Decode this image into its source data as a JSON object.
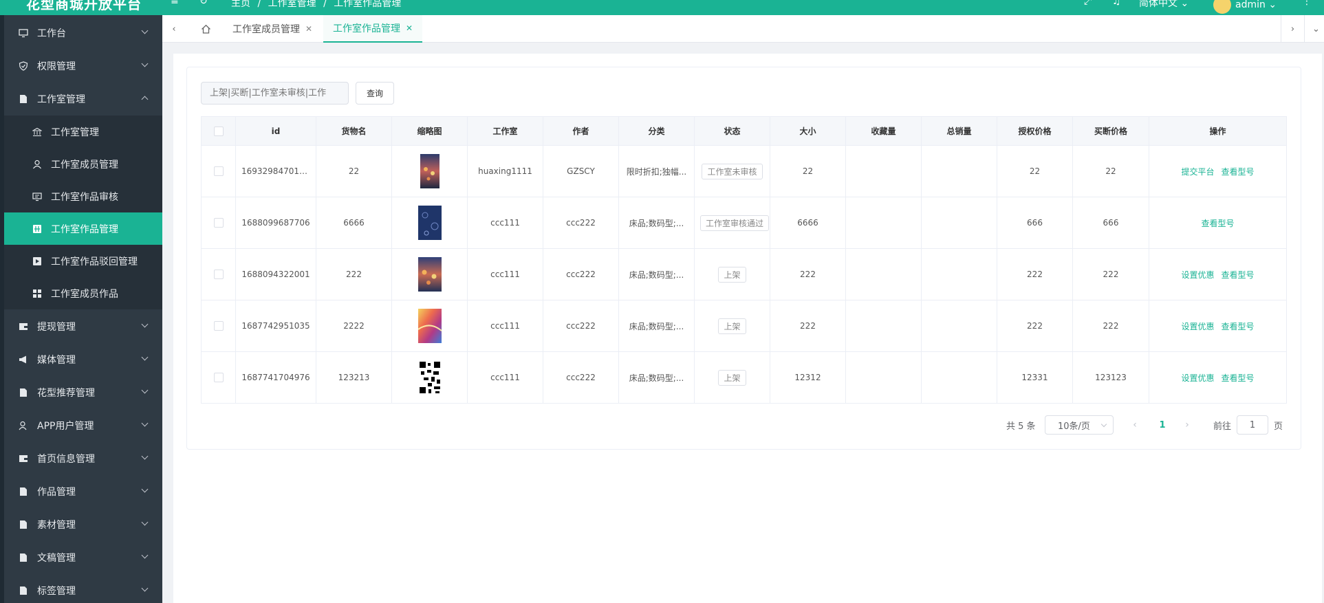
{
  "header": {
    "brand": "花型商城开放平台",
    "breadcrumb": [
      "主页",
      "/",
      "工作室管理",
      "/",
      "工作室作品管理"
    ],
    "language": "简体中文",
    "user": "admin"
  },
  "sidebar": {
    "items": [
      {
        "label": "工作台",
        "icon": "monitor-icon"
      },
      {
        "label": "权限管理",
        "icon": "shield-icon"
      },
      {
        "label": "工作室管理",
        "icon": "document-icon",
        "expanded": true
      },
      {
        "label": "提现管理",
        "icon": "wallet-icon"
      },
      {
        "label": "媒体管理",
        "icon": "megaphone-icon"
      },
      {
        "label": "花型推荐管理",
        "icon": "document-icon"
      },
      {
        "label": "APP用户管理",
        "icon": "user-icon"
      },
      {
        "label": "首页信息管理",
        "icon": "wallet-icon"
      },
      {
        "label": "作品管理",
        "icon": "document-icon"
      },
      {
        "label": "素材管理",
        "icon": "document-icon"
      },
      {
        "label": "文稿管理",
        "icon": "document-icon"
      },
      {
        "label": "标签管理",
        "icon": "document-icon"
      }
    ],
    "subitems": [
      {
        "label": "工作室管理",
        "icon": "bank-icon"
      },
      {
        "label": "工作室成员管理",
        "icon": "user-icon"
      },
      {
        "label": "工作室作品审核",
        "icon": "monitor-icon"
      },
      {
        "label": "工作室作品管理",
        "icon": "grid-icon",
        "active": true
      },
      {
        "label": "工作室作品驳回管理",
        "icon": "play-icon"
      },
      {
        "label": "工作室成员作品",
        "icon": "apps-icon"
      }
    ]
  },
  "tabs": [
    {
      "label": "工作室成员管理",
      "active": false
    },
    {
      "label": "工作室作品管理",
      "active": true
    }
  ],
  "search": {
    "placeholder": "上架|买断|工作室未审核|工作",
    "button": "查询"
  },
  "table": {
    "columns": [
      "id",
      "货物名",
      "缩略图",
      "工作室",
      "作者",
      "分类",
      "状态",
      "大小",
      "收藏量",
      "总销量",
      "授权价格",
      "买断价格",
      "操作"
    ],
    "rows": [
      {
        "id": "169329847016...",
        "name": "22",
        "thumb": "thumb-lanterns",
        "studio": "huaxing1111",
        "author": "GZSCY",
        "category": "限时折扣;独幅...",
        "status": "工作室未审核",
        "size": "22",
        "fav": "",
        "sales": "",
        "license_price": "22",
        "buyout_price": "22",
        "actions": [
          "提交平台",
          "查看型号"
        ]
      },
      {
        "id": "1688099687706",
        "name": "6666",
        "thumb": "thumb-navy-floral",
        "studio": "ccc111",
        "author": "ccc222",
        "category": "床品;数码型;...",
        "status": "工作室审核通过",
        "size": "6666",
        "fav": "",
        "sales": "",
        "license_price": "666",
        "buyout_price": "666",
        "actions": [
          "查看型号"
        ]
      },
      {
        "id": "1688094322001",
        "name": "222",
        "thumb": "thumb-lanterns",
        "studio": "ccc111",
        "author": "ccc222",
        "category": "床品;数码型;...",
        "status": "上架",
        "size": "222",
        "fav": "",
        "sales": "",
        "license_price": "222",
        "buyout_price": "222",
        "actions": [
          "设置优惠",
          "查看型号"
        ]
      },
      {
        "id": "1687742951035",
        "name": "2222",
        "thumb": "thumb-colorful",
        "studio": "ccc111",
        "author": "ccc222",
        "category": "床品;数码型;...",
        "status": "上架",
        "size": "222",
        "fav": "",
        "sales": "",
        "license_price": "222",
        "buyout_price": "222",
        "actions": [
          "设置优惠",
          "查看型号"
        ]
      },
      {
        "id": "1687741704976",
        "name": "123213",
        "thumb": "thumb-qrcode",
        "studio": "ccc111",
        "author": "ccc222",
        "category": "床品;数码型;...",
        "status": "上架",
        "size": "12312",
        "fav": "",
        "sales": "",
        "license_price": "12331",
        "buyout_price": "123123",
        "actions": [
          "设置优惠",
          "查看型号"
        ]
      }
    ]
  },
  "pagination": {
    "total": "共 5 条",
    "page_size": "10条/页",
    "current": "1",
    "goto_label": "前往",
    "goto_value": "1",
    "page_suffix": "页"
  },
  "colors": {
    "accent": "#1ab394",
    "sidebar": "#2f3a44"
  }
}
